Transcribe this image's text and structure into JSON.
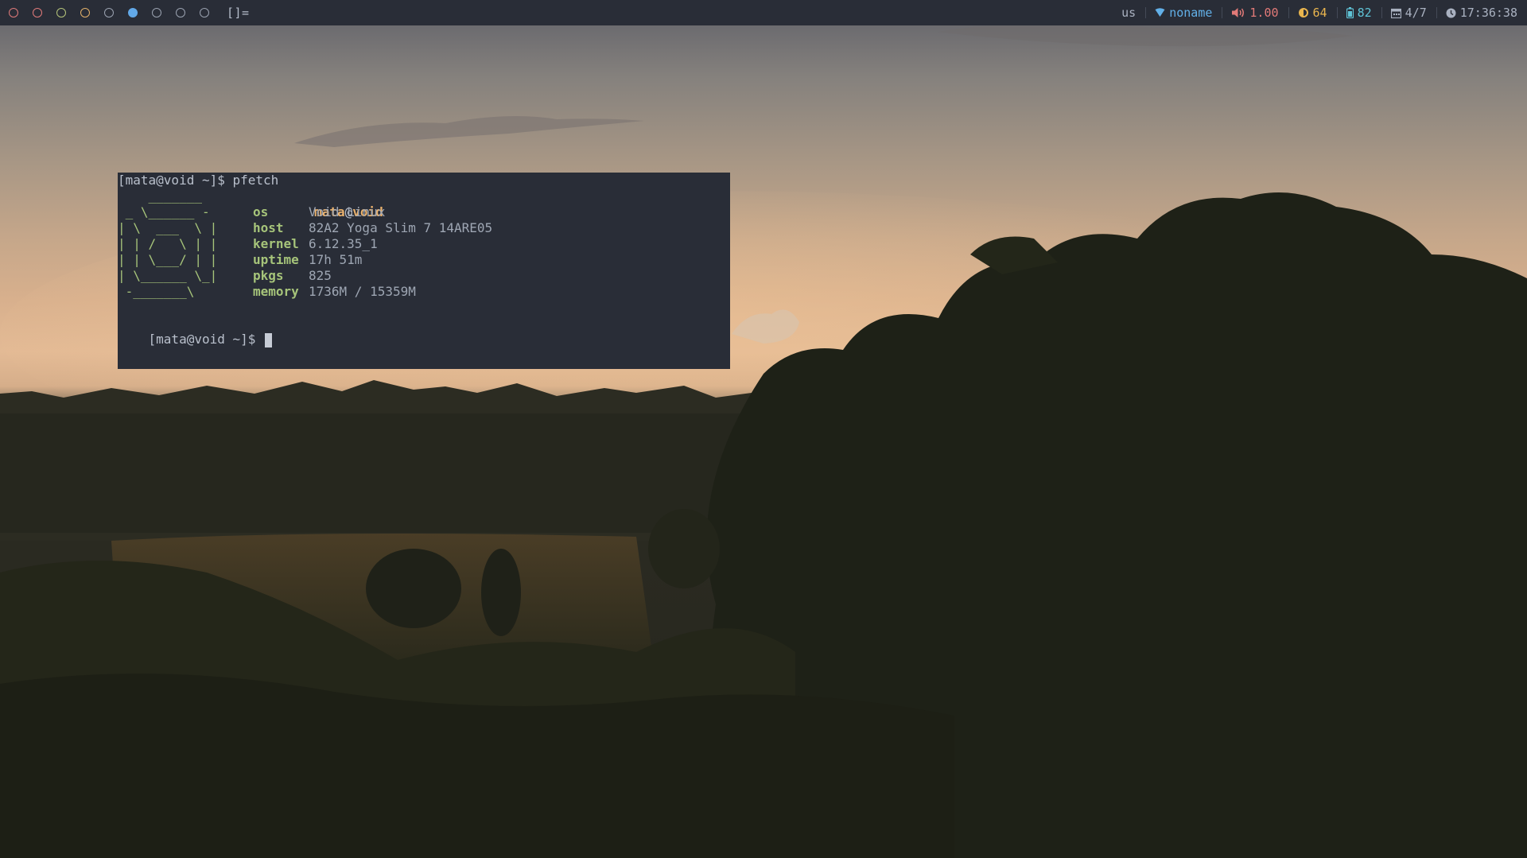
{
  "topbar": {
    "tags": [
      {
        "name": "tag-1",
        "color": "#e07a7a",
        "active": false
      },
      {
        "name": "tag-2",
        "color": "#e07a7a",
        "active": false
      },
      {
        "name": "tag-3",
        "color": "#b5c47a",
        "active": false
      },
      {
        "name": "tag-4",
        "color": "#e3b16a",
        "active": false
      },
      {
        "name": "tag-5",
        "color": "#9aa2b0",
        "active": false
      },
      {
        "name": "tag-6",
        "color": "#62a9e8",
        "active": true
      },
      {
        "name": "tag-7",
        "color": "#9aa2b0",
        "active": false
      },
      {
        "name": "tag-8",
        "color": "#9aa2b0",
        "active": false
      },
      {
        "name": "tag-9",
        "color": "#9aa2b0",
        "active": false
      }
    ],
    "layout_symbol": "[]=",
    "status": {
      "keyboard": {
        "text": "us",
        "color": "#a9b1c0"
      },
      "wifi": {
        "icon": "wifi-icon",
        "text": "noname",
        "color": "#62b0e8"
      },
      "volume": {
        "icon": "speaker-icon",
        "text": "1.00",
        "color": "#e27a78"
      },
      "brightness": {
        "icon": "brightness-icon",
        "text": "64",
        "color": "#e9b54e"
      },
      "battery": {
        "icon": "battery-icon",
        "text": "82",
        "color": "#5fc3d6"
      },
      "date": {
        "icon": "calendar-icon",
        "text": "4/7",
        "color": "#a9b1c0"
      },
      "clock": {
        "icon": "clock-icon",
        "text": "17:36:38",
        "color": "#a9b1c0"
      }
    }
  },
  "terminal": {
    "prompt": "[mata@void ~]$",
    "command": "pfetch",
    "prompt_line_1": "[mata@void ~]$ pfetch",
    "ascii_logo": "    _______\n _ \\______ -\n| \\  ___  \\ |\n| | /   \\ | |\n| | \\___/ | |\n| \\______ \\_|\n -_______\\",
    "user": "mata",
    "at": "@",
    "hostname": "void",
    "info": [
      {
        "key": "os",
        "value": "Void Linux"
      },
      {
        "key": "host",
        "value": "82A2 Yoga Slim 7 14ARE05"
      },
      {
        "key": "kernel",
        "value": "6.12.35_1"
      },
      {
        "key": "uptime",
        "value": "17h 51m"
      },
      {
        "key": "pkgs",
        "value": "825"
      },
      {
        "key": "memory",
        "value": "1736M / 15359M"
      }
    ],
    "ascii_color": "#a6c47a",
    "bg_color": "#292d37"
  }
}
